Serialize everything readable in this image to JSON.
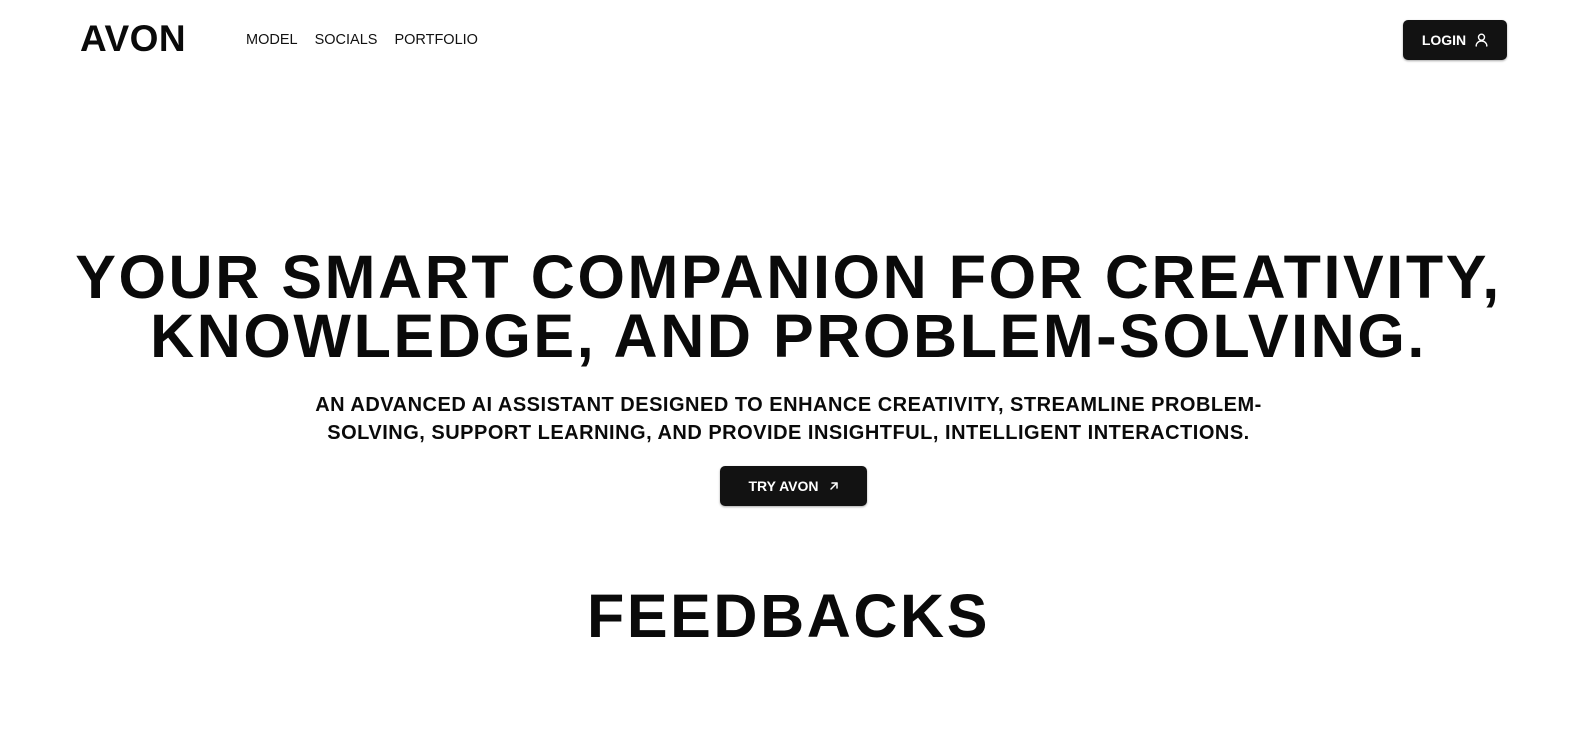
{
  "nav": {
    "logo": "AVON",
    "links": [
      {
        "label": "MODEL"
      },
      {
        "label": "SOCIALS"
      },
      {
        "label": "PORTFOLIO"
      }
    ],
    "login_label": "LOGIN",
    "login_icon": "user-icon"
  },
  "hero": {
    "title_line1": "YOUR SMART COMPANION FOR CREATIVITY,",
    "title_line2": "KNOWLEDGE, AND PROBLEM-SOLVING.",
    "subtitle_line1": "AN ADVANCED AI ASSISTANT DESIGNED TO ENHANCE CREATIVITY, STREAMLINE PROBLEM-",
    "subtitle_line2": "SOLVING, SUPPORT LEARNING, AND PROVIDE INSIGHTFUL, INTELLIGENT INTERACTIONS.",
    "cta_label": "TRY AVON",
    "cta_icon": "arrow-up-right-icon"
  },
  "feedbacks": {
    "title": "FEEDBACKS"
  },
  "colors": {
    "button_bg": "#121212",
    "text": "#0a0a0a",
    "background": "#ffffff"
  }
}
